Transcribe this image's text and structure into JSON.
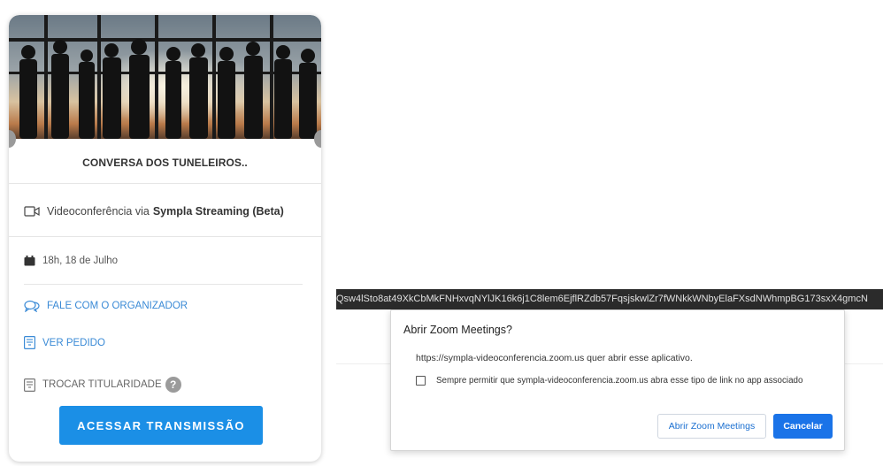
{
  "ticket": {
    "banner_image": "silhouettes-business-people-photo",
    "event_title": "CONVERSA DOS TUNELEIROS..",
    "video": {
      "icon": "video-camera-icon",
      "prefix": "Videoconferência via",
      "platform": "Sympla Streaming (Beta)"
    },
    "date": {
      "icon": "calendar-icon",
      "text": "18h, 18 de Julho"
    },
    "links": {
      "organizer": {
        "icon": "chat-bubbles-icon",
        "label": "FALE COM O ORGANIZADOR"
      },
      "order": {
        "icon": "receipt-icon",
        "label": "VER PEDIDO"
      },
      "transfer": {
        "icon": "receipt-icon",
        "label": "TROCAR TITULARIDADE",
        "help": "?"
      }
    },
    "access_button": "ACESSAR TRANSMISSÃO",
    "colors": {
      "accent": "#1b8fe6",
      "link": "#3a8ad6"
    }
  },
  "browser": {
    "url_fragment": "Qsw4lSto8at49XkCbMkFNHxvqNYlJK16k6j1C8lem6EjflRZdb57FqsjskwlZr7fWNkkWNbyElaFXsdNWhmpBG173sxX4gmcN"
  },
  "dialog": {
    "title": "Abrir Zoom Meetings?",
    "message": "https://sympla-videoconferencia.zoom.us quer abrir esse aplicativo.",
    "checkbox_label": "Sempre permitir que sympla-videoconferencia.zoom.us abra esse tipo de link no app associado",
    "checkbox_checked": false,
    "open_button": "Abrir Zoom Meetings",
    "cancel_button": "Cancelar",
    "colors": {
      "primary": "#1a73e8"
    }
  }
}
